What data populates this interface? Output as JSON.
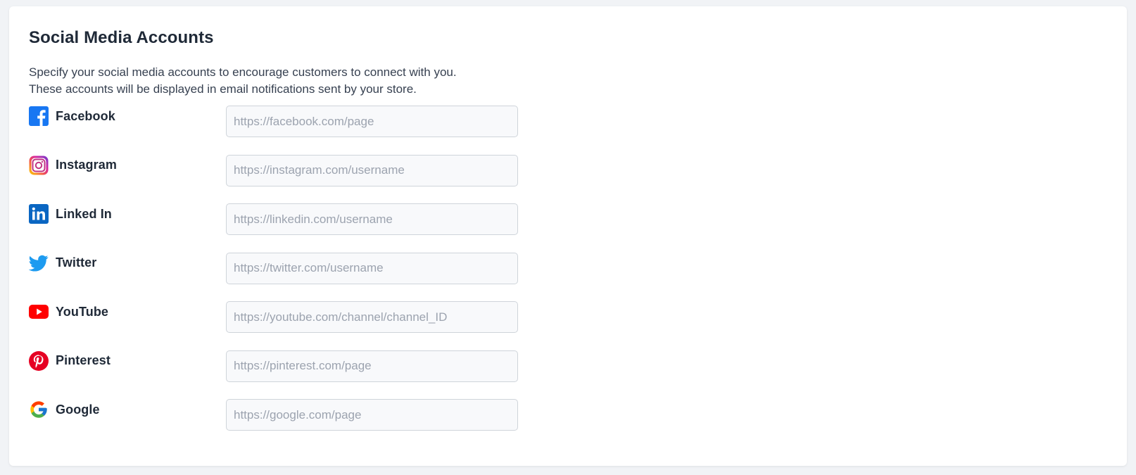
{
  "section": {
    "title": "Social Media Accounts",
    "description_line1": "Specify your social media accounts to encourage customers to connect with you.",
    "description_line2": "These accounts will be displayed in email notifications sent by your store."
  },
  "accounts": [
    {
      "label": "Facebook",
      "icon": "facebook-icon",
      "value": "",
      "placeholder": "https://facebook.com/page",
      "brand_color": "#1877f2"
    },
    {
      "label": "Instagram",
      "icon": "instagram-icon",
      "value": "",
      "placeholder": "https://instagram.com/username",
      "brand_color": "#d6249f"
    },
    {
      "label": "Linked In",
      "icon": "linkedin-icon",
      "value": "",
      "placeholder": "https://linkedin.com/username",
      "brand_color": "#0a66c2"
    },
    {
      "label": "Twitter",
      "icon": "twitter-icon",
      "value": "",
      "placeholder": "https://twitter.com/username",
      "brand_color": "#1d9bf0"
    },
    {
      "label": "YouTube",
      "icon": "youtube-icon",
      "value": "",
      "placeholder": "https://youtube.com/channel/channel_ID",
      "brand_color": "#ff0000"
    },
    {
      "label": "Pinterest",
      "icon": "pinterest-icon",
      "value": "",
      "placeholder": "https://pinterest.com/page",
      "brand_color": "#e60023"
    },
    {
      "label": "Google",
      "icon": "google-icon",
      "value": "",
      "placeholder": "https://google.com/page",
      "brand_color": "#4285f4"
    }
  ]
}
